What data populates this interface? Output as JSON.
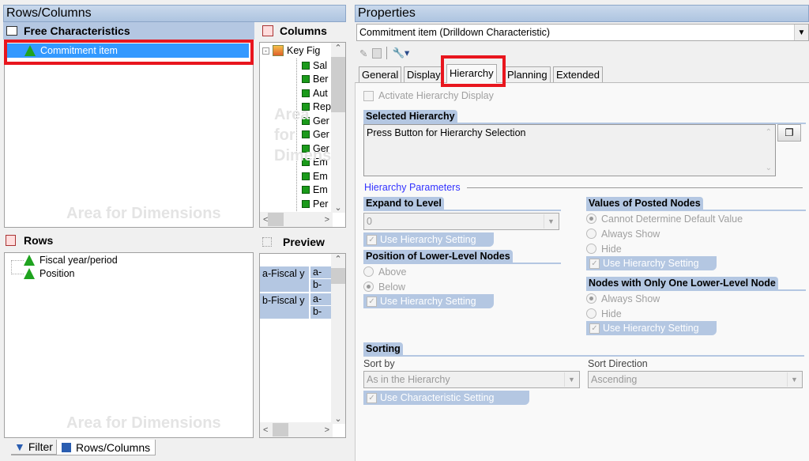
{
  "left": {
    "title": "Rows/Columns",
    "free": {
      "title": "Free Characteristics",
      "items": [
        "Commitment item"
      ],
      "watermark": "Area for Dimensions"
    },
    "columns": {
      "title": "Columns",
      "root": "Key Fig",
      "items": [
        "Sal",
        "Ber",
        "Aut",
        "Rep",
        "Ger",
        "Ger",
        "Ger",
        "Em",
        "Em",
        "Em",
        "Per"
      ],
      "watermark": "Area for Dimensions"
    },
    "rows": {
      "title": "Rows",
      "items": [
        "Fiscal year/period",
        "Position"
      ],
      "watermark": "Area for Dimensions"
    },
    "preview": {
      "title": "Preview",
      "cells": [
        [
          "a-Fiscal y",
          "a-Po",
          "b-Po"
        ],
        [
          "b-Fiscal y",
          "a-Po",
          "b-Po"
        ]
      ]
    },
    "bottom_tabs": [
      "Filter",
      "Rows/Columns"
    ]
  },
  "right": {
    "title": "Properties",
    "object_select": "Commitment item (Drilldown Characteristic)",
    "tabs": [
      "General",
      "Display",
      "Hierarchy",
      "Planning",
      "Extended"
    ],
    "active_tab": "Hierarchy",
    "activate_label": "Activate Hierarchy Display",
    "selected_hierarchy": {
      "title": "Selected Hierarchy",
      "text": "Press Button for Hierarchy Selection"
    },
    "params_title": "Hierarchy Parameters",
    "expand": {
      "title": "Expand to Level",
      "value": "0",
      "use": "Use Hierarchy Setting"
    },
    "position": {
      "title": "Position of Lower-Level Nodes",
      "options": [
        "Above",
        "Below"
      ],
      "selected": "Below",
      "use": "Use Hierarchy Setting"
    },
    "posted": {
      "title": "Values of Posted Nodes",
      "options": [
        "Cannot Determine Default Value",
        "Always Show",
        "Hide"
      ],
      "selected": "Cannot Determine Default Value",
      "use": "Use Hierarchy Setting"
    },
    "onechild": {
      "title": "Nodes with Only One Lower-Level Node",
      "options": [
        "Always Show",
        "Hide"
      ],
      "selected": "Always Show",
      "use": "Use Hierarchy Setting"
    },
    "sorting": {
      "title": "Sorting",
      "sort_by_label": "Sort by",
      "sort_by": "As in the Hierarchy",
      "dir_label": "Sort Direction",
      "dir": "Ascending",
      "use": "Use Characteristic Setting"
    }
  },
  "colors": {
    "highlight": "#3399ff",
    "group": "#b4c7e2",
    "annotation": "#e8161e"
  }
}
